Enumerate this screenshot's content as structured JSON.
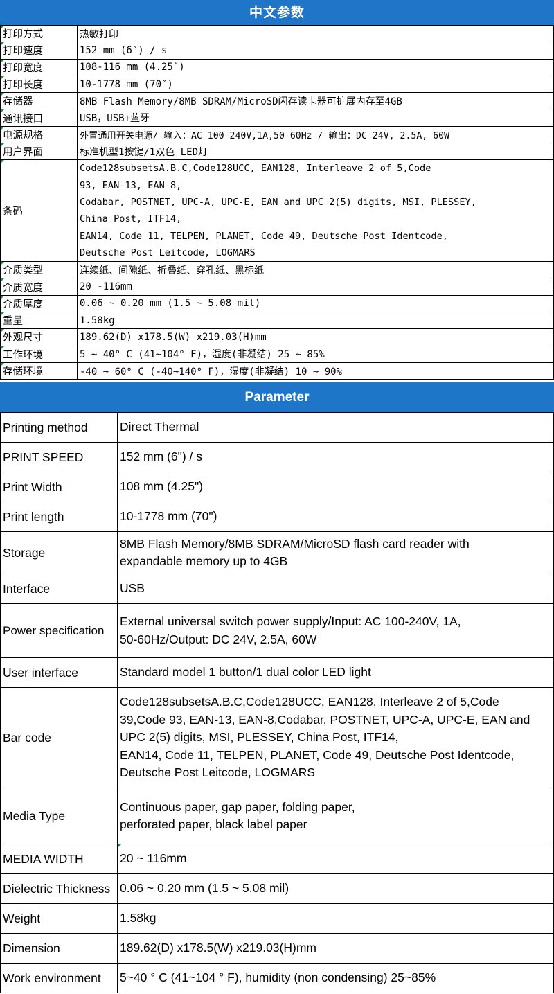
{
  "zh": {
    "title": "中文参数",
    "rows": [
      {
        "key": "打印方式",
        "value": "热敏打印"
      },
      {
        "key": "打印速度",
        "value": "152 mm (6″) / s"
      },
      {
        "key": "打印宽度",
        "value": "108-116 mm (4.25″)"
      },
      {
        "key": "打印长度",
        "value": " 10-1778 mm (70″)"
      },
      {
        "key": "存储器",
        "value": " 8MB Flash Memory/8MB SDRAM/MicroSD闪存读卡器可扩展内存至4GB"
      },
      {
        "key": "通讯接口",
        "value": "USB，USB+蓝牙"
      },
      {
        "key": "电源规格",
        "value": "外置通用开关电源/ 输入：AC 100-240V,1A,50-60Hz / 输出：DC 24V, 2.5A, 60W"
      },
      {
        "key": "用户界面",
        "value": "标准机型1按键/1双色 LED灯"
      },
      {
        "key": "条码",
        "value": "Code128subsetsA.B.C,Code128UCC, EAN128, Interleave 2 of 5,Code\n93, EAN-13, EAN-8,\n Codabar, POSTNET, UPC-A, UPC-E, EAN and UPC 2(5) digits, MSI, PLESSEY,\nChina Post, ITF14,\nEAN14, Code 11, TELPEN, PLANET, Code 49, Deutsche Post Identcode,\nDeutsche Post Leitcode, LOGMARS"
      },
      {
        "key": "介质类型",
        "value": " 连续纸、间隙纸、折叠纸、穿孔纸、黑标纸"
      },
      {
        "key": "介质宽度",
        "value": " 20 -116mm"
      },
      {
        "key": "介质厚度",
        "value": " 0.06 ~ 0.20 mm (1.5 ~ 5.08 mil)"
      },
      {
        "key": "重量",
        "value": "1.58kg"
      },
      {
        "key": "外观尺寸",
        "value": "189.62(D) x178.5(W) x219.03(H)mm"
      },
      {
        "key": "工作环境",
        "value": "5 ~ 40° C (41~104° F)，湿度(非凝结) 25 ~ 85%"
      },
      {
        "key": "存储环境",
        "value": "-40 ~ 60° C (-40~140° F)，湿度(非凝结) 10 ~ 90%"
      }
    ]
  },
  "en": {
    "title": "Parameter",
    "rows": [
      {
        "key": "Printing method",
        "value": "Direct Thermal"
      },
      {
        "key": "PRINT SPEED",
        "value": "152 mm (6\") / s"
      },
      {
        "key": "Print Width",
        "value": "108 mm (4.25\")"
      },
      {
        "key": "Print length",
        "value": " 10-1778 mm (70\")"
      },
      {
        "key": "Storage",
        "value": "8MB Flash Memory/8MB SDRAM/MicroSD flash card reader with\n expandable memory up to 4GB"
      },
      {
        "key": "Interface",
        "value": "USB"
      },
      {
        "key": "Power specification",
        "value": "External universal switch power supply/Input: AC 100-240V, 1A,\n50-60Hz/Output: DC 24V, 2.5A, 60W"
      },
      {
        "key": "User interface",
        "value": "Standard model 1 button/1 dual color LED light"
      },
      {
        "key": "Bar code",
        "value": "Code128subsetsA.B.C,Code128UCC, EAN128, Interleave 2 of 5,Code\n39,Code 93, EAN-13, EAN-8,Codabar, POSTNET, UPC-A, UPC-E, EAN and\nUPC 2(5) digits, MSI, PLESSEY, China Post, ITF14,\nEAN14, Code 11, TELPEN, PLANET, Code 49, Deutsche Post Identcode,\nDeutsche Post Leitcode, LOGMARS"
      },
      {
        "key": "Media Type",
        "value": "Continuous paper, gap paper, folding paper,\n perforated paper, black label paper"
      },
      {
        "key": "MEDIA WIDTH",
        "value": " 20 ~ 116mm"
      },
      {
        "key": "Dielectric Thickness",
        "value": " 0.06 ~ 0.20 mm (1.5 ~ 5.08 mil)"
      },
      {
        "key": "Weight",
        "value": "1.58kg"
      },
      {
        "key": "Dimension",
        "value": "189.62(D) x178.5(W) x219.03(H)mm"
      },
      {
        "key": "Work environment",
        "value": "5~40 ° C (41~104 ° F), humidity (non condensing) 25~85%"
      }
    ]
  }
}
